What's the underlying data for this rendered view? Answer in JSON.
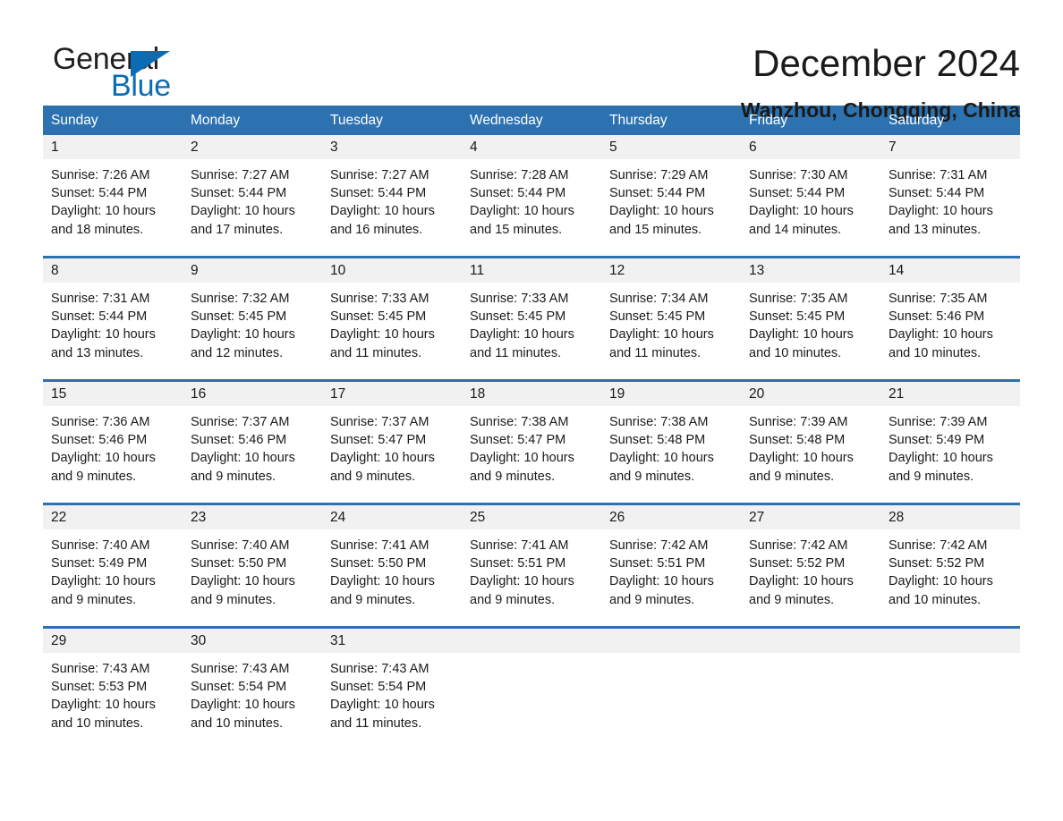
{
  "brand": {
    "name_part1": "General",
    "name_part2": "Blue",
    "triangle_color": "#0b6cb4"
  },
  "header": {
    "title": "December 2024",
    "subtitle": "Wanzhou, Chongqing, China"
  },
  "theme": {
    "header_blue": "#2C72B0",
    "daynum_band": "#f1f1f1",
    "text": "#1a1a1a"
  },
  "weekdays": [
    "Sunday",
    "Monday",
    "Tuesday",
    "Wednesday",
    "Thursday",
    "Friday",
    "Saturday"
  ],
  "weeks": [
    [
      {
        "day": "1",
        "lines": [
          "Sunrise: 7:26 AM",
          "Sunset: 5:44 PM",
          "Daylight: 10 hours",
          "and 18 minutes."
        ]
      },
      {
        "day": "2",
        "lines": [
          "Sunrise: 7:27 AM",
          "Sunset: 5:44 PM",
          "Daylight: 10 hours",
          "and 17 minutes."
        ]
      },
      {
        "day": "3",
        "lines": [
          "Sunrise: 7:27 AM",
          "Sunset: 5:44 PM",
          "Daylight: 10 hours",
          "and 16 minutes."
        ]
      },
      {
        "day": "4",
        "lines": [
          "Sunrise: 7:28 AM",
          "Sunset: 5:44 PM",
          "Daylight: 10 hours",
          "and 15 minutes."
        ]
      },
      {
        "day": "5",
        "lines": [
          "Sunrise: 7:29 AM",
          "Sunset: 5:44 PM",
          "Daylight: 10 hours",
          "and 15 minutes."
        ]
      },
      {
        "day": "6",
        "lines": [
          "Sunrise: 7:30 AM",
          "Sunset: 5:44 PM",
          "Daylight: 10 hours",
          "and 14 minutes."
        ]
      },
      {
        "day": "7",
        "lines": [
          "Sunrise: 7:31 AM",
          "Sunset: 5:44 PM",
          "Daylight: 10 hours",
          "and 13 minutes."
        ]
      }
    ],
    [
      {
        "day": "8",
        "lines": [
          "Sunrise: 7:31 AM",
          "Sunset: 5:44 PM",
          "Daylight: 10 hours",
          "and 13 minutes."
        ]
      },
      {
        "day": "9",
        "lines": [
          "Sunrise: 7:32 AM",
          "Sunset: 5:45 PM",
          "Daylight: 10 hours",
          "and 12 minutes."
        ]
      },
      {
        "day": "10",
        "lines": [
          "Sunrise: 7:33 AM",
          "Sunset: 5:45 PM",
          "Daylight: 10 hours",
          "and 11 minutes."
        ]
      },
      {
        "day": "11",
        "lines": [
          "Sunrise: 7:33 AM",
          "Sunset: 5:45 PM",
          "Daylight: 10 hours",
          "and 11 minutes."
        ]
      },
      {
        "day": "12",
        "lines": [
          "Sunrise: 7:34 AM",
          "Sunset: 5:45 PM",
          "Daylight: 10 hours",
          "and 11 minutes."
        ]
      },
      {
        "day": "13",
        "lines": [
          "Sunrise: 7:35 AM",
          "Sunset: 5:45 PM",
          "Daylight: 10 hours",
          "and 10 minutes."
        ]
      },
      {
        "day": "14",
        "lines": [
          "Sunrise: 7:35 AM",
          "Sunset: 5:46 PM",
          "Daylight: 10 hours",
          "and 10 minutes."
        ]
      }
    ],
    [
      {
        "day": "15",
        "lines": [
          "Sunrise: 7:36 AM",
          "Sunset: 5:46 PM",
          "Daylight: 10 hours",
          "and 9 minutes."
        ]
      },
      {
        "day": "16",
        "lines": [
          "Sunrise: 7:37 AM",
          "Sunset: 5:46 PM",
          "Daylight: 10 hours",
          "and 9 minutes."
        ]
      },
      {
        "day": "17",
        "lines": [
          "Sunrise: 7:37 AM",
          "Sunset: 5:47 PM",
          "Daylight: 10 hours",
          "and 9 minutes."
        ]
      },
      {
        "day": "18",
        "lines": [
          "Sunrise: 7:38 AM",
          "Sunset: 5:47 PM",
          "Daylight: 10 hours",
          "and 9 minutes."
        ]
      },
      {
        "day": "19",
        "lines": [
          "Sunrise: 7:38 AM",
          "Sunset: 5:48 PM",
          "Daylight: 10 hours",
          "and 9 minutes."
        ]
      },
      {
        "day": "20",
        "lines": [
          "Sunrise: 7:39 AM",
          "Sunset: 5:48 PM",
          "Daylight: 10 hours",
          "and 9 minutes."
        ]
      },
      {
        "day": "21",
        "lines": [
          "Sunrise: 7:39 AM",
          "Sunset: 5:49 PM",
          "Daylight: 10 hours",
          "and 9 minutes."
        ]
      }
    ],
    [
      {
        "day": "22",
        "lines": [
          "Sunrise: 7:40 AM",
          "Sunset: 5:49 PM",
          "Daylight: 10 hours",
          "and 9 minutes."
        ]
      },
      {
        "day": "23",
        "lines": [
          "Sunrise: 7:40 AM",
          "Sunset: 5:50 PM",
          "Daylight: 10 hours",
          "and 9 minutes."
        ]
      },
      {
        "day": "24",
        "lines": [
          "Sunrise: 7:41 AM",
          "Sunset: 5:50 PM",
          "Daylight: 10 hours",
          "and 9 minutes."
        ]
      },
      {
        "day": "25",
        "lines": [
          "Sunrise: 7:41 AM",
          "Sunset: 5:51 PM",
          "Daylight: 10 hours",
          "and 9 minutes."
        ]
      },
      {
        "day": "26",
        "lines": [
          "Sunrise: 7:42 AM",
          "Sunset: 5:51 PM",
          "Daylight: 10 hours",
          "and 9 minutes."
        ]
      },
      {
        "day": "27",
        "lines": [
          "Sunrise: 7:42 AM",
          "Sunset: 5:52 PM",
          "Daylight: 10 hours",
          "and 9 minutes."
        ]
      },
      {
        "day": "28",
        "lines": [
          "Sunrise: 7:42 AM",
          "Sunset: 5:52 PM",
          "Daylight: 10 hours",
          "and 10 minutes."
        ]
      }
    ],
    [
      {
        "day": "29",
        "lines": [
          "Sunrise: 7:43 AM",
          "Sunset: 5:53 PM",
          "Daylight: 10 hours",
          "and 10 minutes."
        ]
      },
      {
        "day": "30",
        "lines": [
          "Sunrise: 7:43 AM",
          "Sunset: 5:54 PM",
          "Daylight: 10 hours",
          "and 10 minutes."
        ]
      },
      {
        "day": "31",
        "lines": [
          "Sunrise: 7:43 AM",
          "Sunset: 5:54 PM",
          "Daylight: 10 hours",
          "and 11 minutes."
        ]
      },
      {
        "day": "",
        "lines": []
      },
      {
        "day": "",
        "lines": []
      },
      {
        "day": "",
        "lines": []
      },
      {
        "day": "",
        "lines": []
      }
    ]
  ]
}
